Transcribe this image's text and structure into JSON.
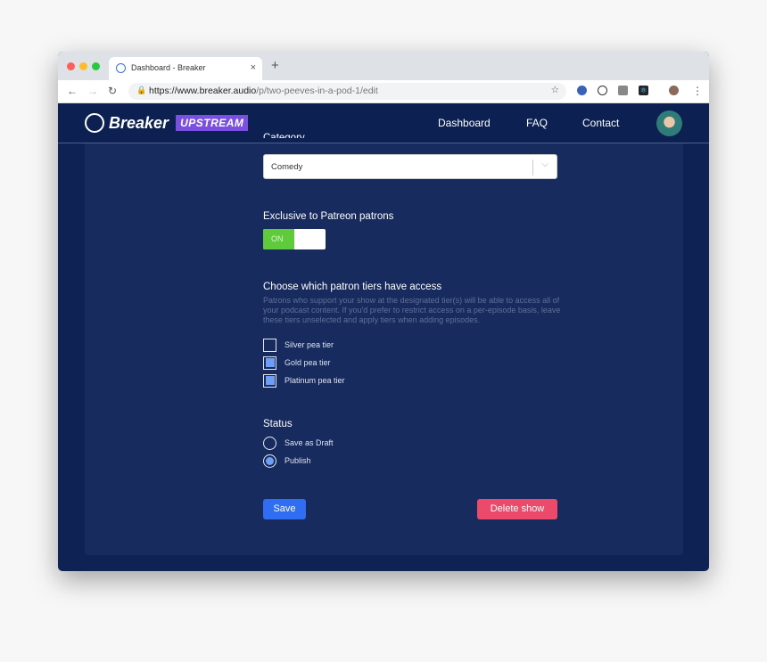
{
  "browser": {
    "tab_title": "Dashboard - Breaker",
    "url_host": "https://www.breaker.audio",
    "url_path": "/p/two-peeves-in-a-pod-1/edit",
    "new_tab": "+",
    "close": "×"
  },
  "nav": {
    "brand": "Breaker",
    "badge": "UPSTREAM",
    "links": [
      "Dashboard",
      "FAQ",
      "Contact"
    ]
  },
  "form": {
    "category": {
      "label": "Category",
      "value": "Comedy"
    },
    "exclusive": {
      "label": "Exclusive to Patreon patrons",
      "toggle_label": "ON",
      "on": true
    },
    "tiers": {
      "label": "Choose which patron tiers have access",
      "help": "Patrons who support your show at the designated tier(s) will be able to access all of your podcast content. If you'd prefer to restrict access on a per-episode basis, leave these tiers unselected and apply tiers when adding episodes.",
      "items": [
        {
          "label": "Silver pea tier",
          "checked": false
        },
        {
          "label": "Gold pea tier",
          "checked": true
        },
        {
          "label": "Platinum pea tier",
          "checked": true
        }
      ]
    },
    "status": {
      "label": "Status",
      "options": [
        {
          "label": "Save as Draft",
          "selected": false
        },
        {
          "label": "Publish",
          "selected": true
        }
      ]
    },
    "save": "Save",
    "delete": "Delete show"
  },
  "colors": {
    "save": "#2f6ef2",
    "delete": "#ec4a6a",
    "toggle_on": "#5fcb3c",
    "checked": "#6e9ef5"
  }
}
